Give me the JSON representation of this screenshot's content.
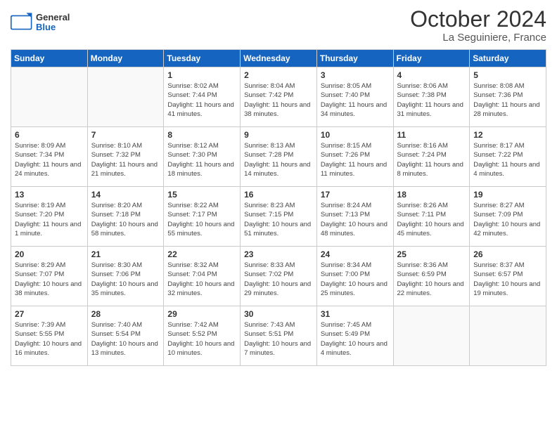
{
  "header": {
    "logo": {
      "general": "General",
      "blue": "Blue"
    },
    "title": "October 2024",
    "location": "La Seguiniere, France"
  },
  "calendar": {
    "days_of_week": [
      "Sunday",
      "Monday",
      "Tuesday",
      "Wednesday",
      "Thursday",
      "Friday",
      "Saturday"
    ],
    "weeks": [
      [
        {
          "day": "",
          "info": ""
        },
        {
          "day": "",
          "info": ""
        },
        {
          "day": "1",
          "info": "Sunrise: 8:02 AM\nSunset: 7:44 PM\nDaylight: 11 hours and 41 minutes."
        },
        {
          "day": "2",
          "info": "Sunrise: 8:04 AM\nSunset: 7:42 PM\nDaylight: 11 hours and 38 minutes."
        },
        {
          "day": "3",
          "info": "Sunrise: 8:05 AM\nSunset: 7:40 PM\nDaylight: 11 hours and 34 minutes."
        },
        {
          "day": "4",
          "info": "Sunrise: 8:06 AM\nSunset: 7:38 PM\nDaylight: 11 hours and 31 minutes."
        },
        {
          "day": "5",
          "info": "Sunrise: 8:08 AM\nSunset: 7:36 PM\nDaylight: 11 hours and 28 minutes."
        }
      ],
      [
        {
          "day": "6",
          "info": "Sunrise: 8:09 AM\nSunset: 7:34 PM\nDaylight: 11 hours and 24 minutes."
        },
        {
          "day": "7",
          "info": "Sunrise: 8:10 AM\nSunset: 7:32 PM\nDaylight: 11 hours and 21 minutes."
        },
        {
          "day": "8",
          "info": "Sunrise: 8:12 AM\nSunset: 7:30 PM\nDaylight: 11 hours and 18 minutes."
        },
        {
          "day": "9",
          "info": "Sunrise: 8:13 AM\nSunset: 7:28 PM\nDaylight: 11 hours and 14 minutes."
        },
        {
          "day": "10",
          "info": "Sunrise: 8:15 AM\nSunset: 7:26 PM\nDaylight: 11 hours and 11 minutes."
        },
        {
          "day": "11",
          "info": "Sunrise: 8:16 AM\nSunset: 7:24 PM\nDaylight: 11 hours and 8 minutes."
        },
        {
          "day": "12",
          "info": "Sunrise: 8:17 AM\nSunset: 7:22 PM\nDaylight: 11 hours and 4 minutes."
        }
      ],
      [
        {
          "day": "13",
          "info": "Sunrise: 8:19 AM\nSunset: 7:20 PM\nDaylight: 11 hours and 1 minute."
        },
        {
          "day": "14",
          "info": "Sunrise: 8:20 AM\nSunset: 7:18 PM\nDaylight: 10 hours and 58 minutes."
        },
        {
          "day": "15",
          "info": "Sunrise: 8:22 AM\nSunset: 7:17 PM\nDaylight: 10 hours and 55 minutes."
        },
        {
          "day": "16",
          "info": "Sunrise: 8:23 AM\nSunset: 7:15 PM\nDaylight: 10 hours and 51 minutes."
        },
        {
          "day": "17",
          "info": "Sunrise: 8:24 AM\nSunset: 7:13 PM\nDaylight: 10 hours and 48 minutes."
        },
        {
          "day": "18",
          "info": "Sunrise: 8:26 AM\nSunset: 7:11 PM\nDaylight: 10 hours and 45 minutes."
        },
        {
          "day": "19",
          "info": "Sunrise: 8:27 AM\nSunset: 7:09 PM\nDaylight: 10 hours and 42 minutes."
        }
      ],
      [
        {
          "day": "20",
          "info": "Sunrise: 8:29 AM\nSunset: 7:07 PM\nDaylight: 10 hours and 38 minutes."
        },
        {
          "day": "21",
          "info": "Sunrise: 8:30 AM\nSunset: 7:06 PM\nDaylight: 10 hours and 35 minutes."
        },
        {
          "day": "22",
          "info": "Sunrise: 8:32 AM\nSunset: 7:04 PM\nDaylight: 10 hours and 32 minutes."
        },
        {
          "day": "23",
          "info": "Sunrise: 8:33 AM\nSunset: 7:02 PM\nDaylight: 10 hours and 29 minutes."
        },
        {
          "day": "24",
          "info": "Sunrise: 8:34 AM\nSunset: 7:00 PM\nDaylight: 10 hours and 25 minutes."
        },
        {
          "day": "25",
          "info": "Sunrise: 8:36 AM\nSunset: 6:59 PM\nDaylight: 10 hours and 22 minutes."
        },
        {
          "day": "26",
          "info": "Sunrise: 8:37 AM\nSunset: 6:57 PM\nDaylight: 10 hours and 19 minutes."
        }
      ],
      [
        {
          "day": "27",
          "info": "Sunrise: 7:39 AM\nSunset: 5:55 PM\nDaylight: 10 hours and 16 minutes."
        },
        {
          "day": "28",
          "info": "Sunrise: 7:40 AM\nSunset: 5:54 PM\nDaylight: 10 hours and 13 minutes."
        },
        {
          "day": "29",
          "info": "Sunrise: 7:42 AM\nSunset: 5:52 PM\nDaylight: 10 hours and 10 minutes."
        },
        {
          "day": "30",
          "info": "Sunrise: 7:43 AM\nSunset: 5:51 PM\nDaylight: 10 hours and 7 minutes."
        },
        {
          "day": "31",
          "info": "Sunrise: 7:45 AM\nSunset: 5:49 PM\nDaylight: 10 hours and 4 minutes."
        },
        {
          "day": "",
          "info": ""
        },
        {
          "day": "",
          "info": ""
        }
      ]
    ]
  }
}
